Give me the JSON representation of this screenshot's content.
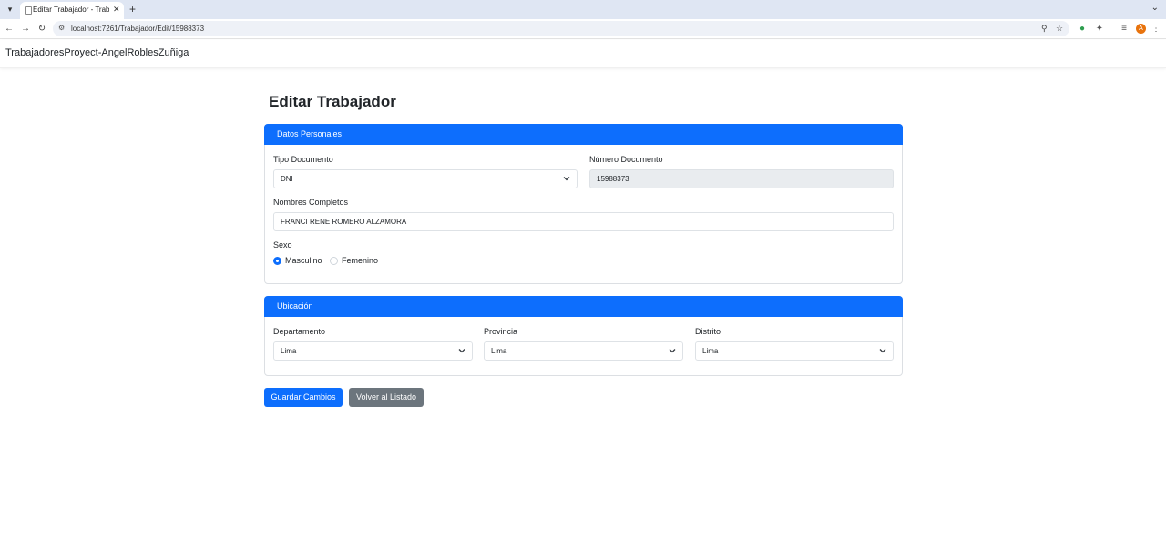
{
  "browser": {
    "tab_title": "Editar Trabajador - TrabajadoresP",
    "tab_close": "✕",
    "new_tab": "+",
    "url": "localhost:7261/Trabajador/Edit/15988373",
    "profile_initial": "A",
    "icons": [
      "tab-menu-icon",
      "favicon-icon",
      "back-icon",
      "forward-icon",
      "reload-icon",
      "site-info-icon",
      "zoom-icon",
      "bookmark-star-icon",
      "extension-green-icon",
      "extensions-puzzle-icon",
      "media-icon",
      "profile-avatar",
      "menu-icon"
    ]
  },
  "navbar": {
    "brand": "TrabajadoresProyect-AngelRoblesZuñiga"
  },
  "page": {
    "title": "Editar Trabajador"
  },
  "personal": {
    "header": "Datos Personales",
    "tipo_documento_label": "Tipo Documento",
    "tipo_documento_value": "DNI",
    "numero_documento_label": "Número Documento",
    "numero_documento_value": "15988373",
    "nombres_label": "Nombres Completos",
    "nombres_value": "FRANCI RENE ROMERO ALZAMORA",
    "sexo_label": "Sexo",
    "sexo_options": [
      "Masculino",
      "Femenino"
    ],
    "sexo_selected": "Masculino"
  },
  "ubicacion": {
    "header": "Ubicación",
    "departamento_label": "Departamento",
    "departamento_value": "Lima",
    "provincia_label": "Provincia",
    "provincia_value": "Lima",
    "distrito_label": "Distrito",
    "distrito_value": "Lima"
  },
  "actions": {
    "save_label": "Guardar Cambios",
    "back_label": "Volver al Listado"
  },
  "colors": {
    "primary": "#0d6efd",
    "secondary": "#6c757d",
    "readonly_bg": "#e9ecef",
    "profile": "#e8730d"
  }
}
